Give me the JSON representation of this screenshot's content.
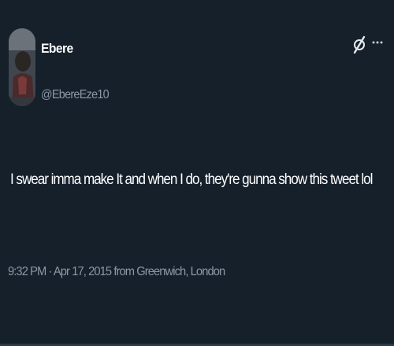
{
  "tweet": {
    "author": {
      "display_name": "Ebere",
      "handle": "@EbereEze10"
    },
    "text": "I swear imma make It and when I do, they're gunna show this tweet lol",
    "timestamp": "9:32 PM · Apr 17, 2015 from Greenwich, London",
    "icons": {
      "header_action": "grok-icon",
      "menu": "more-options-icon"
    }
  },
  "theme": {
    "background": "#15202b",
    "text_primary": "#ffffff",
    "text_secondary": "#8b98a5"
  }
}
